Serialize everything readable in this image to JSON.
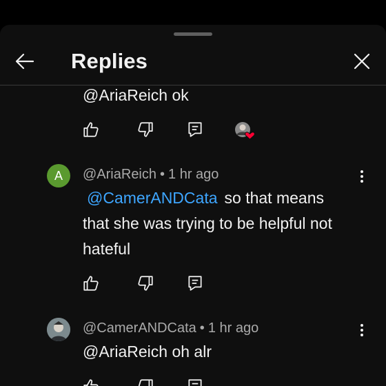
{
  "header": {
    "title": "Replies"
  },
  "comments": [
    {
      "text": "@AriaReich ok"
    },
    {
      "author": "@AriaReich",
      "avatar_letter": "A",
      "avatar_color": "#5a9a2f",
      "time": "1 hr ago",
      "mention": "@CamerANDCata",
      "text_line1": "so that means",
      "text_line2": "that she was trying to be helpful not",
      "text_line3": "hateful"
    },
    {
      "author": "@CamerANDCata",
      "time": "1 hr ago",
      "text": "@AriaReich oh alr"
    }
  ],
  "icons": {
    "back": "arrow-left-icon",
    "close": "close-icon",
    "like": "thumbs-up-icon",
    "dislike": "thumbs-down-icon",
    "reply": "reply-icon",
    "more": "more-vertical-icon",
    "creator_heart": "creator-heart-icon"
  },
  "colors": {
    "background": "#0f0f0f",
    "text": "#f1f1f1",
    "meta": "#aaaaaa",
    "mention": "#3ea6ff",
    "heart": "#ff0033"
  },
  "separator": "•"
}
